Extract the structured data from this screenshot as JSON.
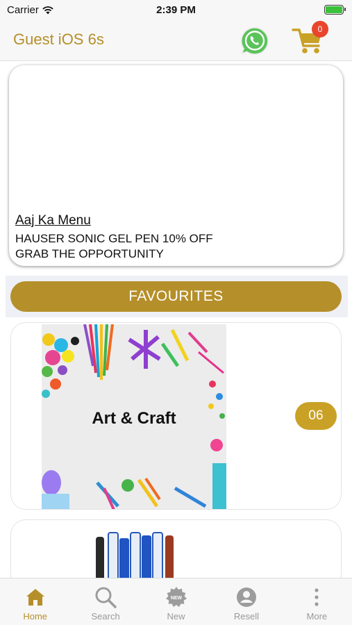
{
  "status_bar": {
    "carrier": "Carrier",
    "time": "2:39 PM"
  },
  "header": {
    "title": "Guest iOS 6s",
    "cart_count": "0",
    "accent_color": "#b58f2a"
  },
  "banner": {
    "heading": "Aaj Ka Menu",
    "line1": "HAUSER SONIC GEL PEN 10% OFF",
    "line2": "GRAB THE OPPORTUNITY"
  },
  "favourites": {
    "label": "FAVOURITES"
  },
  "categories": [
    {
      "caption": "Art & Craft",
      "count": "06"
    },
    {
      "caption": "",
      "count": ""
    }
  ],
  "tab_bar": {
    "tabs": [
      {
        "label": "Home",
        "icon": "home-icon",
        "active": true
      },
      {
        "label": "Search",
        "icon": "search-icon",
        "active": false
      },
      {
        "label": "New",
        "icon": "new-badge-icon",
        "active": false
      },
      {
        "label": "Resell",
        "icon": "user-icon",
        "active": false
      },
      {
        "label": "More",
        "icon": "more-vertical-icon",
        "active": false
      }
    ]
  }
}
